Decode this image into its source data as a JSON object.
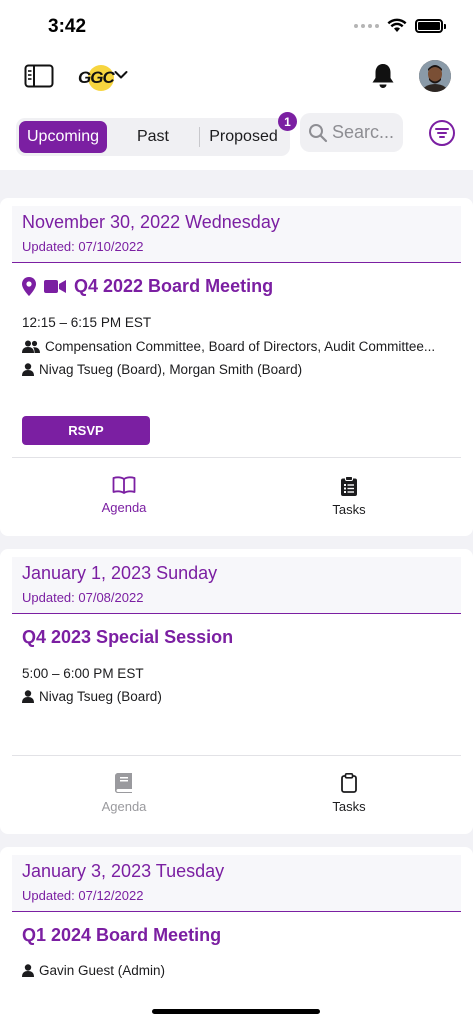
{
  "status_bar": {
    "time": "3:42"
  },
  "header": {
    "logo_text": "GGC"
  },
  "tabs": [
    {
      "label": "Upcoming",
      "active": true
    },
    {
      "label": "Past",
      "active": false
    },
    {
      "label": "Proposed",
      "active": false
    }
  ],
  "proposed_badge": "1",
  "search": {
    "placeholder": "Searc..."
  },
  "colors": {
    "accent": "#7b1fa2",
    "list_bg": "#f2f2f6",
    "muted": "#8e8e93"
  },
  "meetings": [
    {
      "date": "November 30, 2022 Wednesday",
      "updated": "Updated: 07/10/2022",
      "title": "Q4 2022 Board Meeting",
      "time": "12:15 – 6:15 PM EST",
      "committees": "Compensation Committee, Board of Directors, Audit Committee...",
      "attendees": "Nivag Tsueg (Board), Morgan Smith (Board)",
      "rsvp_label": "RSVP",
      "agenda_label": "Agenda",
      "tasks_label": "Tasks"
    },
    {
      "date": "January 1, 2023 Sunday",
      "updated": "Updated: 07/08/2022",
      "title": "Q4 2023 Special Session",
      "time": "5:00 – 6:00 PM EST",
      "attendees": "Nivag Tsueg (Board)",
      "agenda_label": "Agenda",
      "tasks_label": "Tasks"
    },
    {
      "date": "January 3, 2023 Tuesday",
      "updated": "Updated: 07/12/2022",
      "title": "Q1 2024 Board Meeting",
      "attendees": "Gavin Guest (Admin)"
    }
  ]
}
